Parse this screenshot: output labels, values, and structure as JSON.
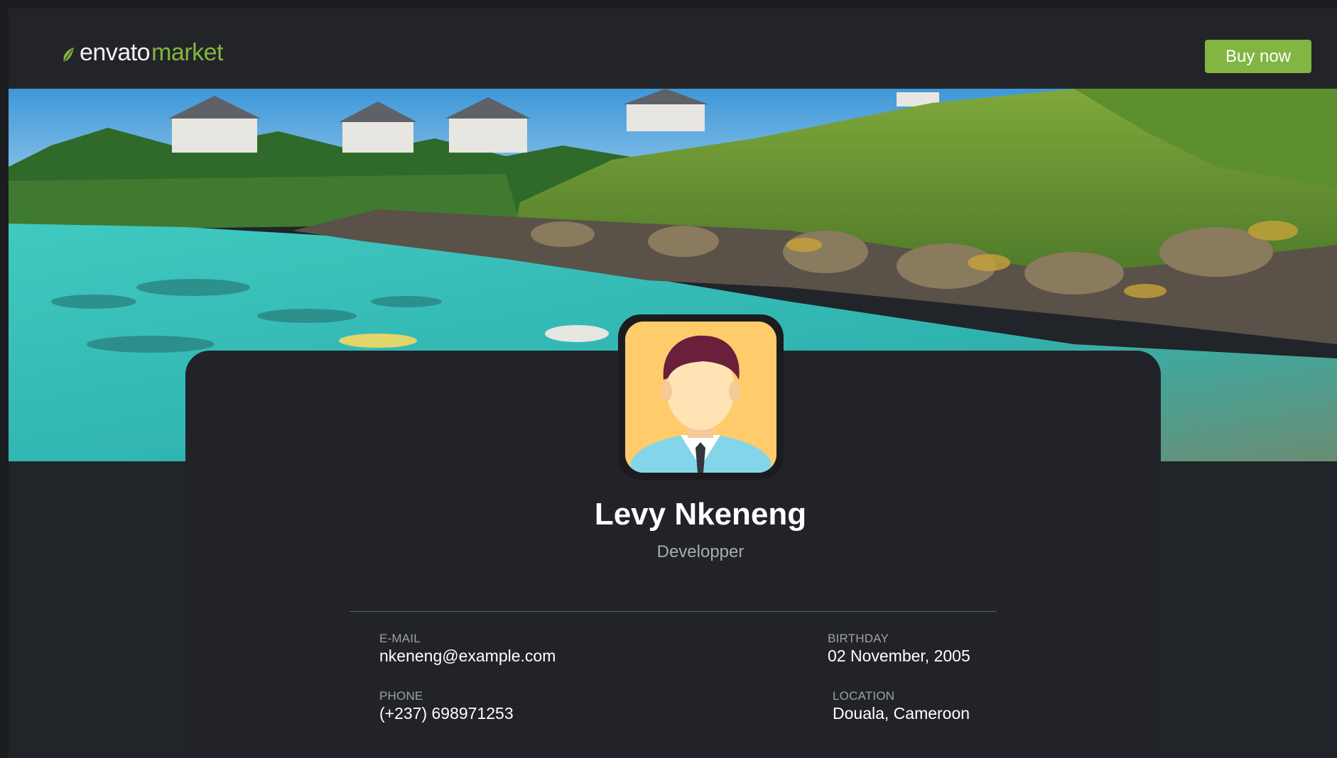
{
  "header": {
    "logo_part1": "envato",
    "logo_part2": "market",
    "buy_label": "Buy now"
  },
  "colors": {
    "brand_green": "#82b541",
    "background": "#212428",
    "card": "#212329",
    "avatar_bg": "#ffcb6b"
  },
  "profile": {
    "name": "Levy Nkeneng",
    "role": "Developper",
    "email_label": "E-MAIL",
    "email": "nkeneng@example.com",
    "birthday_label": "BIRTHDAY",
    "birthday": "02 November, 2005",
    "phone_label": "PHONE",
    "phone": "(+237) 698971253",
    "location_label": "LOCATION",
    "location": "Douala, Cameroon"
  }
}
